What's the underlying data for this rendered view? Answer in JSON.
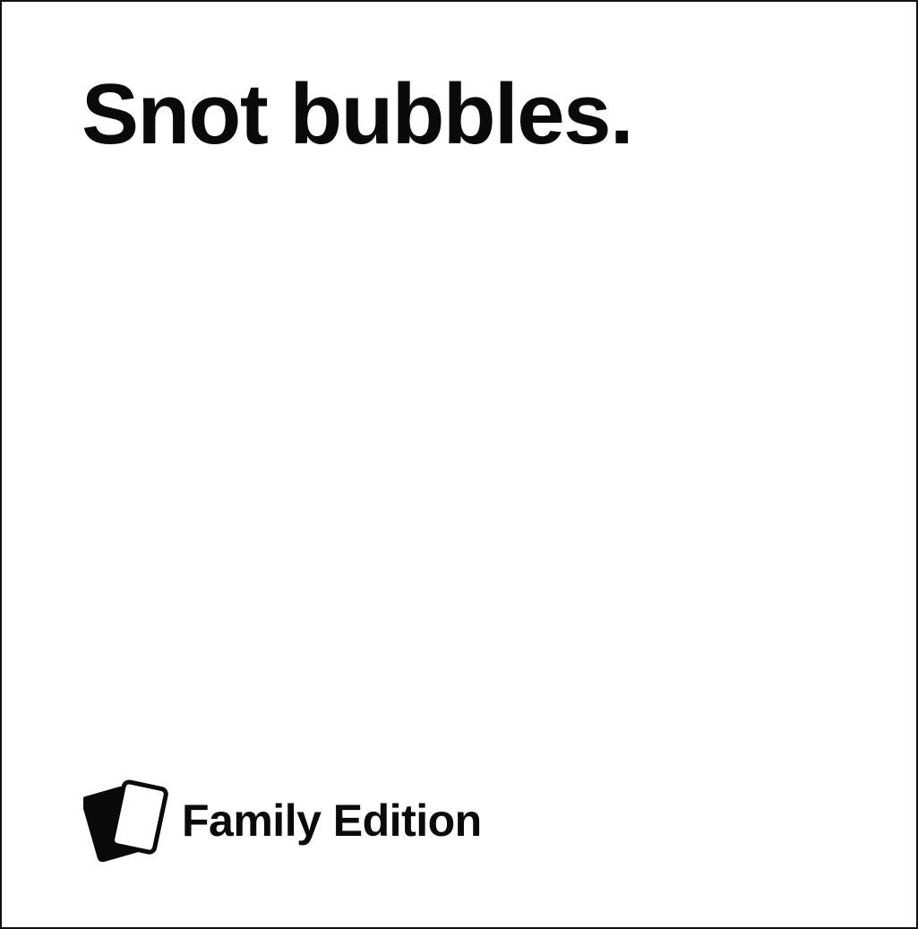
{
  "card": {
    "text": "Snot bubbles.",
    "background_color": "#ffffff",
    "text_color": "#0a0a0a"
  },
  "footer": {
    "icon": "cards-icon",
    "edition_label": "Family Edition"
  }
}
